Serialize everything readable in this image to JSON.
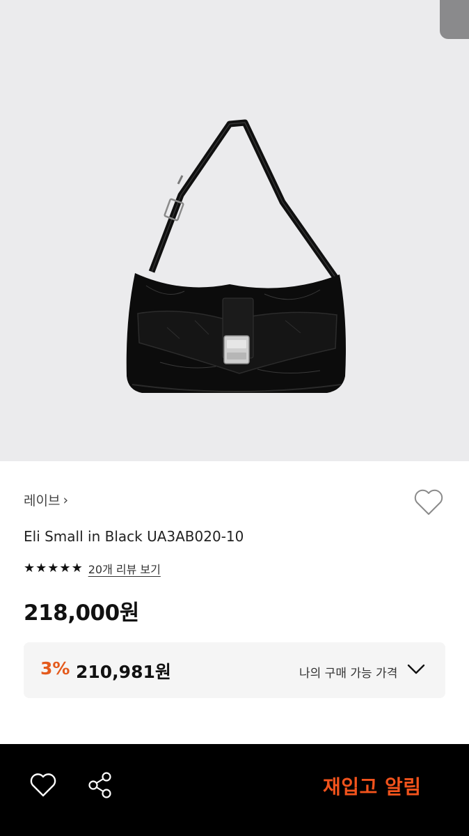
{
  "product": {
    "brand_label": "레이브",
    "brand_chevron": "›",
    "title": "Eli Small in Black UA3AB020-10",
    "image_icon": "shoulder-bag-image",
    "wish_icon": "heart-outline-icon"
  },
  "rating": {
    "stars": [
      "★",
      "★",
      "★",
      "★",
      "★"
    ],
    "review_link": "20개 리뷰 보기"
  },
  "price": {
    "original": "218,000원"
  },
  "discount": {
    "rate": "3%",
    "price": "210,981원",
    "label": "나의 구매 가능 가격",
    "toggle_icon": "chevron-down-icon"
  },
  "bottom_bar": {
    "wish_icon": "heart-outline-icon",
    "share_icon": "share-icon",
    "restock_button": "재입고 알림"
  },
  "colors": {
    "accent": "#e45a1c",
    "restock": "#f2531c",
    "hero_bg": "#ebebed",
    "bottom_bg": "#000000"
  }
}
